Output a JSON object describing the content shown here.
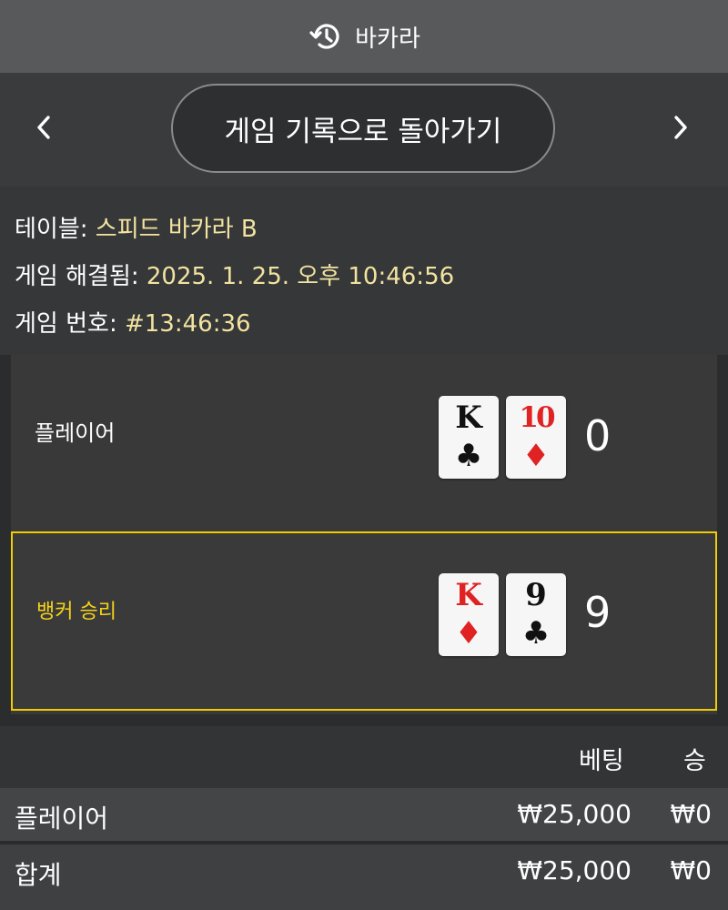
{
  "header": {
    "title": "바카라",
    "icon": "history-icon"
  },
  "nav": {
    "back_label": "게임 기록으로 돌아가기",
    "prev_icon": "chevron-left-icon",
    "next_icon": "chevron-right-icon"
  },
  "info": {
    "table_label": "테이블: ",
    "table_value": "스피드 바카라 B",
    "resolved_label": "게임 해결됨: ",
    "resolved_value": "2025. 1. 25. 오후 10:46:56",
    "number_label": "게임 번호: ",
    "number_value": "#13:46:36"
  },
  "hands": {
    "player": {
      "label": "플레이어",
      "cards": [
        {
          "rank": "K",
          "suit": "♣",
          "suit_name": "club-icon",
          "color": "#111111"
        },
        {
          "rank": "10",
          "suit": "♦",
          "suit_name": "diamond-icon",
          "color": "#e02222"
        }
      ],
      "score": "0"
    },
    "banker": {
      "label": "뱅커 승리",
      "cards": [
        {
          "rank": "K",
          "suit": "♦",
          "suit_name": "diamond-icon",
          "color": "#e02222"
        },
        {
          "rank": "9",
          "suit": "♣",
          "suit_name": "club-icon",
          "color": "#111111"
        }
      ],
      "score": "9",
      "highlight_color": "#f0cc00"
    }
  },
  "bets": {
    "col_bet": "베팅",
    "col_win": "승",
    "rows": [
      {
        "label": "플레이어",
        "bet": "₩25,000",
        "win": "₩0"
      }
    ],
    "total": {
      "label": "합계",
      "bet": "₩25,000",
      "win": "₩0"
    }
  }
}
